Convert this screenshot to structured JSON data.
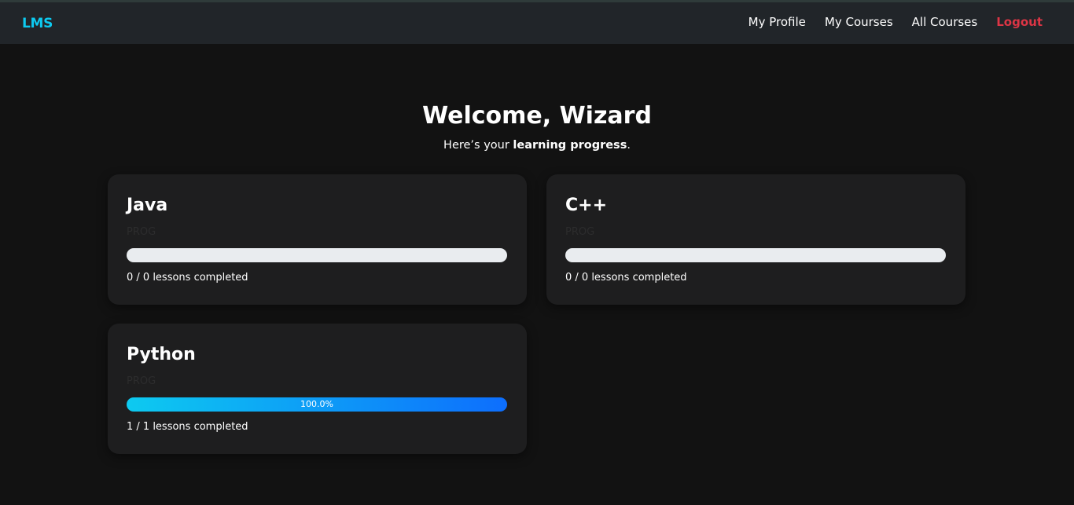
{
  "navbar": {
    "brand": "LMS",
    "links": [
      "My Profile",
      "My Courses",
      "All Courses"
    ],
    "logout": "Logout",
    "brand_color": "#0dcaf0",
    "logout_color": "#dc3545"
  },
  "welcome": {
    "title": "Welcome, Wizard",
    "subtitle_prefix": "Here’s your ",
    "subtitle_bold": "learning progress",
    "subtitle_suffix": "."
  },
  "courses": [
    {
      "title": "Java",
      "code": "PROG",
      "progress_percent": 0,
      "progress_label": "",
      "lessons": "0 / 0 lessons completed"
    },
    {
      "title": "C++",
      "code": "PROG",
      "progress_percent": 0,
      "progress_label": "",
      "lessons": "0 / 0 lessons completed"
    },
    {
      "title": "Python",
      "code": "PROG",
      "progress_percent": 100,
      "progress_label": "100.0%",
      "lessons": "1 / 1 lessons completed"
    }
  ],
  "colors": {
    "background": "#121212",
    "card": "#1e1e1f",
    "progress_start": "#0dcaf0",
    "progress_end": "#0d6efd",
    "progress_track": "#e9ecef"
  }
}
